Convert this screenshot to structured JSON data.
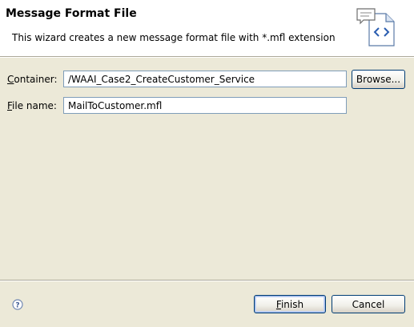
{
  "banner": {
    "title": "Message Format File",
    "description": "This wizard creates a new message format file with *.mfl extension",
    "icon": "message-format-file-icon"
  },
  "form": {
    "container_label": "Container:",
    "container_value": "/WAAI_Case2_CreateCustomer_Service",
    "browse_label": "Browse...",
    "filename_label": "File name:",
    "filename_value": "MailToCustomer.mfl"
  },
  "footer": {
    "help_icon": "help-icon",
    "finish_label": "Finish",
    "cancel_label": "Cancel"
  }
}
